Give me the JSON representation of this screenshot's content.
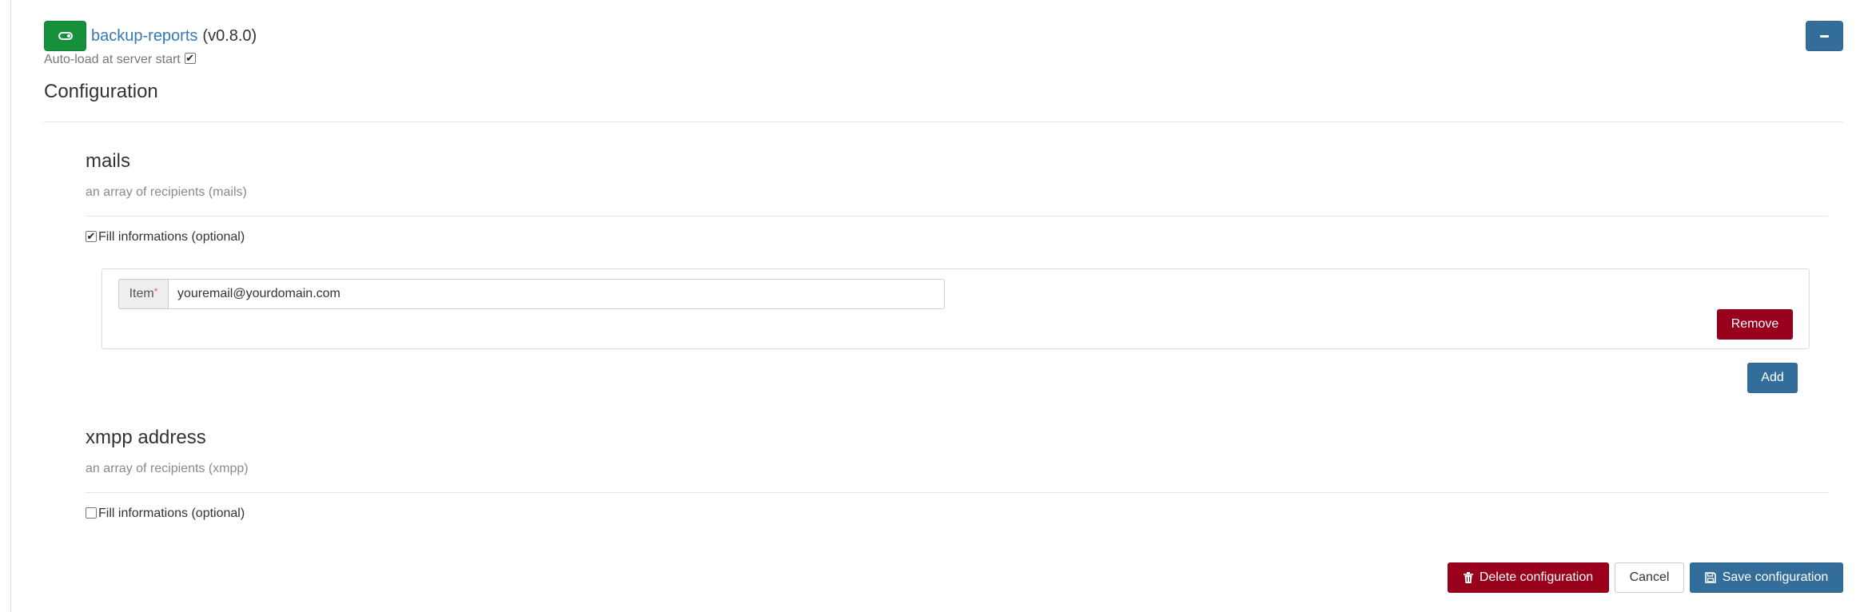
{
  "plugin": {
    "name": "backup-reports",
    "version": "(v0.8.0)",
    "autoload_label": "Auto-load at server start",
    "autoload_checked": true,
    "toggle_color": "#17903c"
  },
  "configuration": {
    "title": "Configuration"
  },
  "sections": [
    {
      "title": "mails",
      "description": "an array of recipients (mails)",
      "fill_label": "Fill informations (optional)",
      "fill_checked": true,
      "items": [
        {
          "addon_label": "Item",
          "required_mark": "*",
          "value": "youremail@yourdomain.com"
        }
      ],
      "remove_label": "Remove",
      "add_label": "Add"
    },
    {
      "title": "xmpp address",
      "description": "an array of recipients (xmpp)",
      "fill_label": "Fill informations (optional)",
      "fill_checked": false
    }
  ],
  "footer": {
    "delete_label": "Delete configuration",
    "cancel_label": "Cancel",
    "save_label": "Save configuration"
  },
  "colors": {
    "primary": "#336e9b",
    "danger": "#98001c",
    "success": "#17903c",
    "link": "#337ab7"
  },
  "icons": {
    "toggle": "toggle-on-icon",
    "collapse": "minus-icon",
    "delete": "trash-icon",
    "save": "floppy-disk-icon"
  }
}
